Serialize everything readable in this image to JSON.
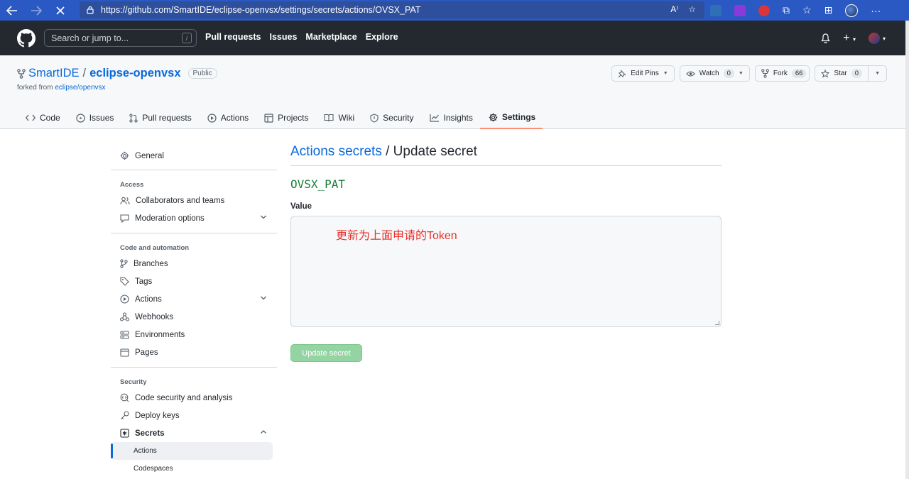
{
  "browser": {
    "url": "https://github.com/SmartIDE/eclipse-openvsx/settings/secrets/actions/OVSX_PAT"
  },
  "header": {
    "search_placeholder": "Search or jump to...",
    "slash_key": "/",
    "nav": [
      "Pull requests",
      "Issues",
      "Marketplace",
      "Explore"
    ]
  },
  "repo": {
    "owner": "SmartIDE",
    "separator": "/",
    "name": "eclipse-openvsx",
    "visibility": "Public",
    "forked_prefix": "forked from",
    "forked_from": "eclipse/openvsx",
    "edit_pins": "Edit Pins",
    "watch_label": "Watch",
    "watch_count": "0",
    "fork_label": "Fork",
    "fork_count": "66",
    "star_label": "Star",
    "star_count": "0"
  },
  "tabs": [
    "Code",
    "Issues",
    "Pull requests",
    "Actions",
    "Projects",
    "Wiki",
    "Security",
    "Insights",
    "Settings"
  ],
  "sidebar": {
    "general": "General",
    "access_heading": "Access",
    "collaborators": "Collaborators and teams",
    "moderation": "Moderation options",
    "code_heading": "Code and automation",
    "branches": "Branches",
    "tags": "Tags",
    "actions": "Actions",
    "webhooks": "Webhooks",
    "environments": "Environments",
    "pages": "Pages",
    "security_heading": "Security",
    "code_security": "Code security and analysis",
    "deploy_keys": "Deploy keys",
    "secrets": "Secrets",
    "secrets_actions": "Actions",
    "secrets_codespaces": "Codespaces"
  },
  "main": {
    "breadcrumb_link": "Actions secrets",
    "breadcrumb_rest": " / Update secret",
    "secret_name": "OVSX_PAT",
    "value_label": "Value",
    "annotation": "更新为上面申请的Token",
    "update_button": "Update secret"
  },
  "colors": {
    "browser_bar": "#2b59c3",
    "gh_header": "#24292f",
    "link": "#0969da",
    "secret_name": "#1a7f37",
    "annotation": "#e8302a",
    "update_button": "#94d3a2",
    "active_tab_underline": "#fd8c73"
  }
}
